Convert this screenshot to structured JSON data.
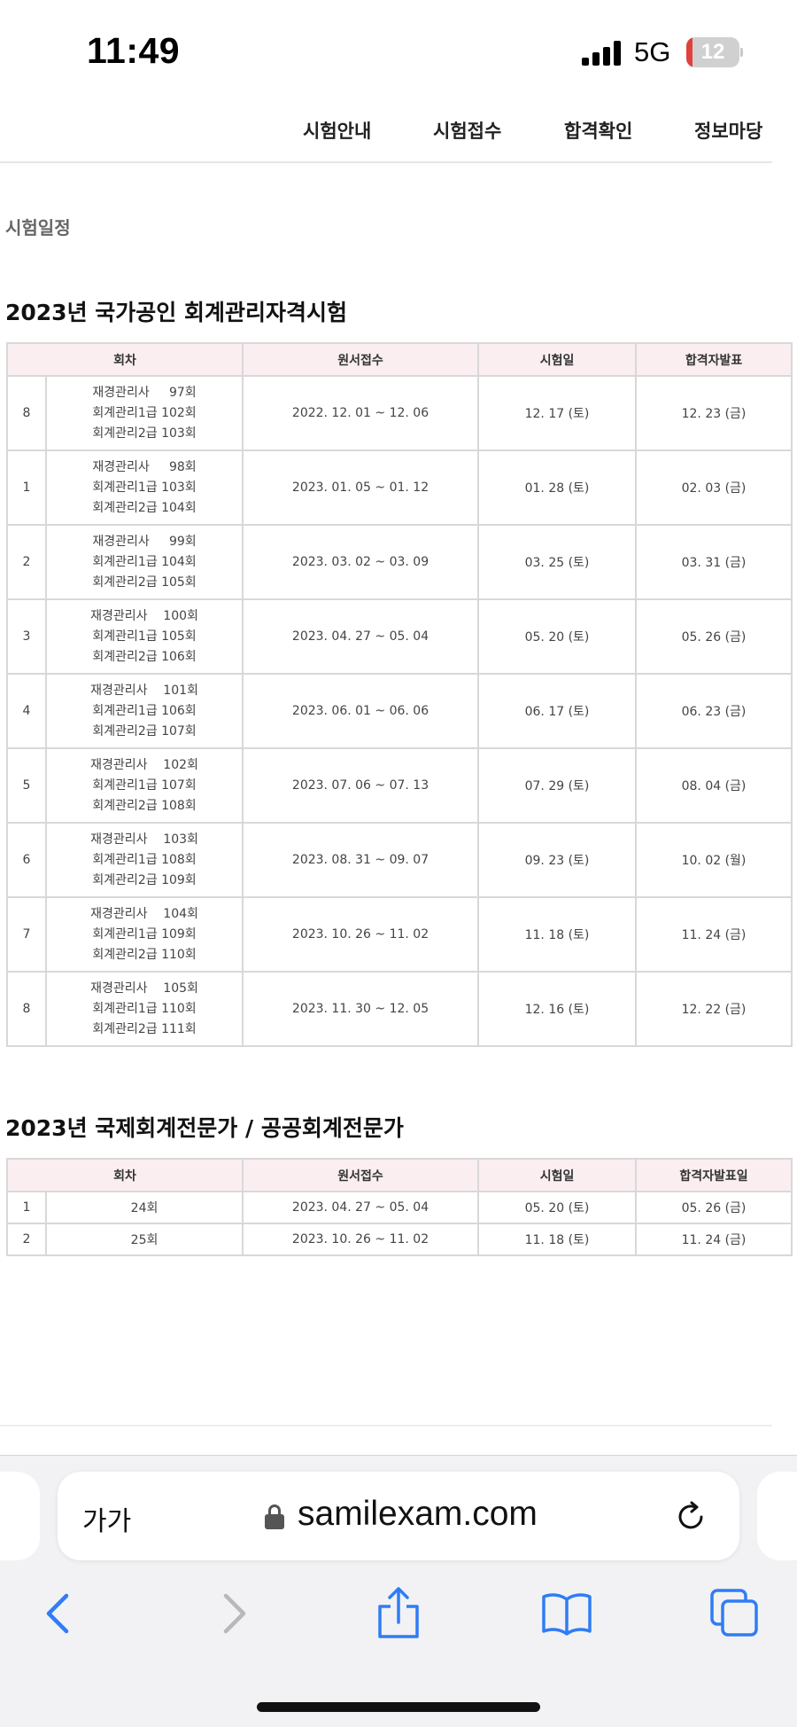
{
  "status_bar": {
    "time": "11:49",
    "network": "5G",
    "battery_level": "12",
    "battery_fraction": 0.12
  },
  "nav": {
    "items": [
      "시험안내",
      "시험접수",
      "합격확인",
      "정보마당"
    ]
  },
  "breadcrumb": "시험일정",
  "schedule1": {
    "title": "2023년 국가공인 회계관리자격시험",
    "headers": [
      "회차",
      "원서접수",
      "시험일",
      "합격자발표"
    ],
    "rows": [
      {
        "no": "8",
        "round_lines": [
          "재경관리사     97회",
          "회계관리1급 102회",
          "회계관리2급 103회"
        ],
        "application": "2022. 12. 01 ~ 12. 06",
        "exam_date": "12. 17 (토)",
        "announce": "12. 23 (금)"
      },
      {
        "no": "1",
        "round_lines": [
          "재경관리사     98회",
          "회계관리1급 103회",
          "회계관리2급 104회"
        ],
        "application": "2023. 01. 05 ~ 01. 12",
        "exam_date": "01. 28 (토)",
        "announce": "02. 03 (금)"
      },
      {
        "no": "2",
        "round_lines": [
          "재경관리사     99회",
          "회계관리1급 104회",
          "회계관리2급 105회"
        ],
        "application": "2023. 03. 02 ~ 03. 09",
        "exam_date": "03. 25 (토)",
        "announce": "03. 31 (금)"
      },
      {
        "no": "3",
        "round_lines": [
          "재경관리사    100회",
          "회계관리1급 105회",
          "회계관리2급 106회"
        ],
        "application": "2023. 04. 27 ~ 05. 04",
        "exam_date": "05. 20 (토)",
        "announce": "05. 26 (금)"
      },
      {
        "no": "4",
        "round_lines": [
          "재경관리사    101회",
          "회계관리1급 106회",
          "회계관리2급 107회"
        ],
        "application": "2023. 06. 01 ~ 06. 06",
        "exam_date": "06. 17 (토)",
        "announce": "06. 23 (금)"
      },
      {
        "no": "5",
        "round_lines": [
          "재경관리사    102회",
          "회계관리1급 107회",
          "회계관리2급 108회"
        ],
        "application": "2023. 07. 06 ~ 07. 13",
        "exam_date": "07. 29 (토)",
        "announce": "08. 04 (금)"
      },
      {
        "no": "6",
        "round_lines": [
          "재경관리사    103회",
          "회계관리1급 108회",
          "회계관리2급 109회"
        ],
        "application": "2023. 08. 31 ~ 09. 07",
        "exam_date": "09. 23 (토)",
        "announce": "10. 02 (월)"
      },
      {
        "no": "7",
        "round_lines": [
          "재경관리사    104회",
          "회계관리1급 109회",
          "회계관리2급 110회"
        ],
        "application": "2023. 10. 26 ~ 11. 02",
        "exam_date": "11. 18 (토)",
        "announce": "11. 24 (금)"
      },
      {
        "no": "8",
        "round_lines": [
          "재경관리사    105회",
          "회계관리1급 110회",
          "회계관리2급 111회"
        ],
        "application": "2023. 11. 30 ~ 12. 05",
        "exam_date": "12. 16 (토)",
        "announce": "12. 22 (금)"
      }
    ]
  },
  "schedule2": {
    "title": "2023년 국제회계전문가 / 공공회계전문가",
    "headers": [
      "회차",
      "원서접수",
      "시험일",
      "합격자발표일"
    ],
    "rows": [
      {
        "no": "1",
        "round": "24회",
        "application": "2023. 04. 27 ~ 05. 04",
        "exam_date": "05. 20 (토)",
        "announce": "05. 26 (금)"
      },
      {
        "no": "2",
        "round": "25회",
        "application": "2023. 10. 26 ~ 11. 02",
        "exam_date": "11. 18 (토)",
        "announce": "11. 24 (금)"
      }
    ]
  },
  "safari": {
    "text_size_label": "가가",
    "url": "samilexam.com",
    "accent_color": "#2f7cf6"
  }
}
